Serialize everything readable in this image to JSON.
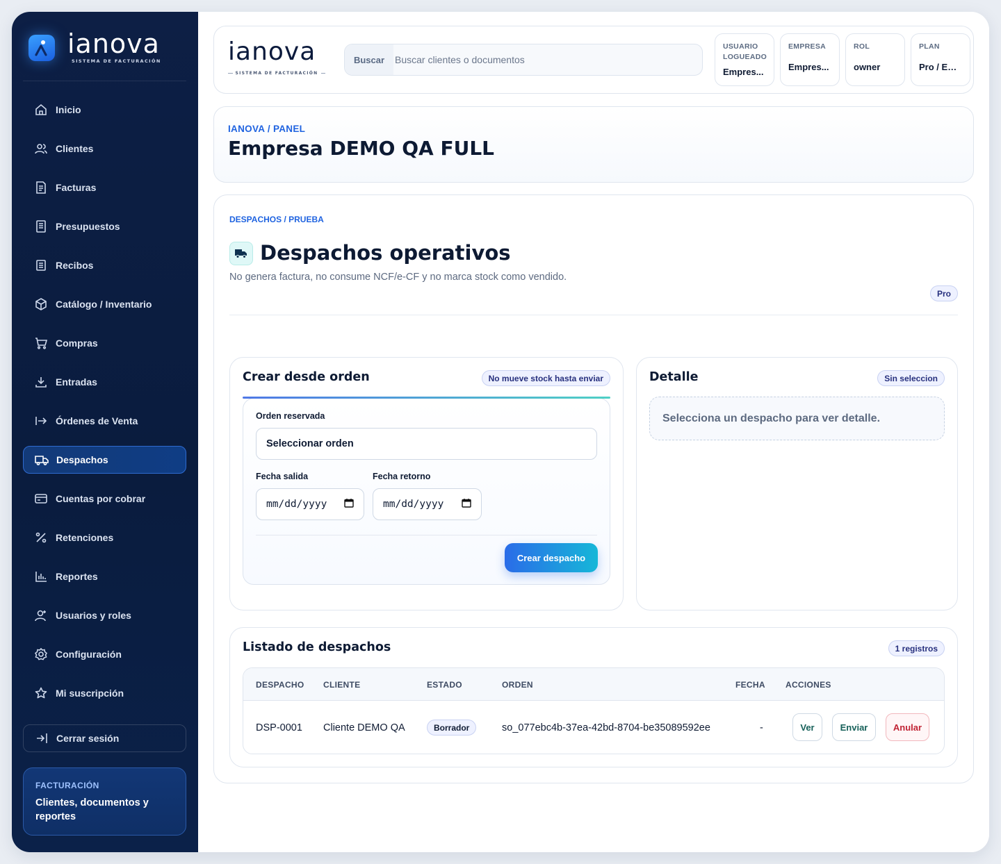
{
  "brand": {
    "word": "ianova",
    "tagline": "SISTEMA DE FACTURACIÓN"
  },
  "sidebar": {
    "items": [
      {
        "label": "Inicio",
        "icon": "home-icon"
      },
      {
        "label": "Clientes",
        "icon": "users-icon"
      },
      {
        "label": "Facturas",
        "icon": "invoice-icon"
      },
      {
        "label": "Presupuestos",
        "icon": "quote-icon"
      },
      {
        "label": "Recibos",
        "icon": "receipt-icon"
      },
      {
        "label": "Catálogo / Inventario",
        "icon": "box-icon"
      },
      {
        "label": "Compras",
        "icon": "cart-icon"
      },
      {
        "label": "Entradas",
        "icon": "download-icon"
      },
      {
        "label": "Órdenes de Venta",
        "icon": "arrow-right-icon"
      },
      {
        "label": "Despachos",
        "icon": "truck-icon",
        "active": true
      },
      {
        "label": "Cuentas por cobrar",
        "icon": "card-icon"
      },
      {
        "label": "Retenciones",
        "icon": "percent-icon"
      },
      {
        "label": "Reportes",
        "icon": "bar-chart-icon"
      },
      {
        "label": "Usuarios y roles",
        "icon": "user-icon"
      },
      {
        "label": "Configuración",
        "icon": "gear-icon"
      },
      {
        "label": "Mi suscripción",
        "icon": "star-icon"
      }
    ],
    "logout_label": "Cerrar sesión",
    "promo": {
      "kicker": "FACTURACIÓN",
      "text": "Clientes, documentos y reportes"
    }
  },
  "topbar": {
    "search_label": "Buscar",
    "search_placeholder": "Buscar clientes o documentos",
    "chips": [
      {
        "key": "USUARIO LOGUEADO",
        "value": "Empres..."
      },
      {
        "key": "EMPRESA",
        "value": "Empres..."
      },
      {
        "key": "ROL",
        "value": "owner"
      },
      {
        "key": "PLAN",
        "value": "Pro / Em..."
      }
    ]
  },
  "header": {
    "breadcrumb": "IANOVA / PANEL",
    "title": "Empresa DEMO QA FULL"
  },
  "page": {
    "breadcrumb": "DESPACHOS / PRUEBA",
    "title": "Despachos operativos",
    "subtitle": "No genera factura, no consume NCF/e-CF y no marca stock como vendido.",
    "plan_badge": "Pro"
  },
  "create": {
    "title": "Crear desde orden",
    "badge": "No mueve stock hasta enviar",
    "order_label": "Orden reservada",
    "order_value": "Seleccionar orden",
    "departure_label": "Fecha salida",
    "return_label": "Fecha retorno",
    "date_placeholder": "mm/dd/yyyy",
    "submit_label": "Crear despacho"
  },
  "detail": {
    "title": "Detalle",
    "badge": "Sin seleccion",
    "empty_text": "Selecciona un despacho para ver detalle."
  },
  "list": {
    "title": "Listado de despachos",
    "count_badge": "1 registros",
    "columns": [
      "DESPACHO",
      "CLIENTE",
      "ESTADO",
      "ORDEN",
      "FECHA",
      "ACCIONES"
    ],
    "rows": [
      {
        "id": "DSP-0001",
        "client": "Cliente DEMO QA",
        "status": "Borrador",
        "order": "so_077ebc4b-37ea-42bd-8704-be35089592ee",
        "date": "-",
        "actions": [
          "Ver",
          "Enviar",
          "Anular"
        ]
      }
    ]
  }
}
